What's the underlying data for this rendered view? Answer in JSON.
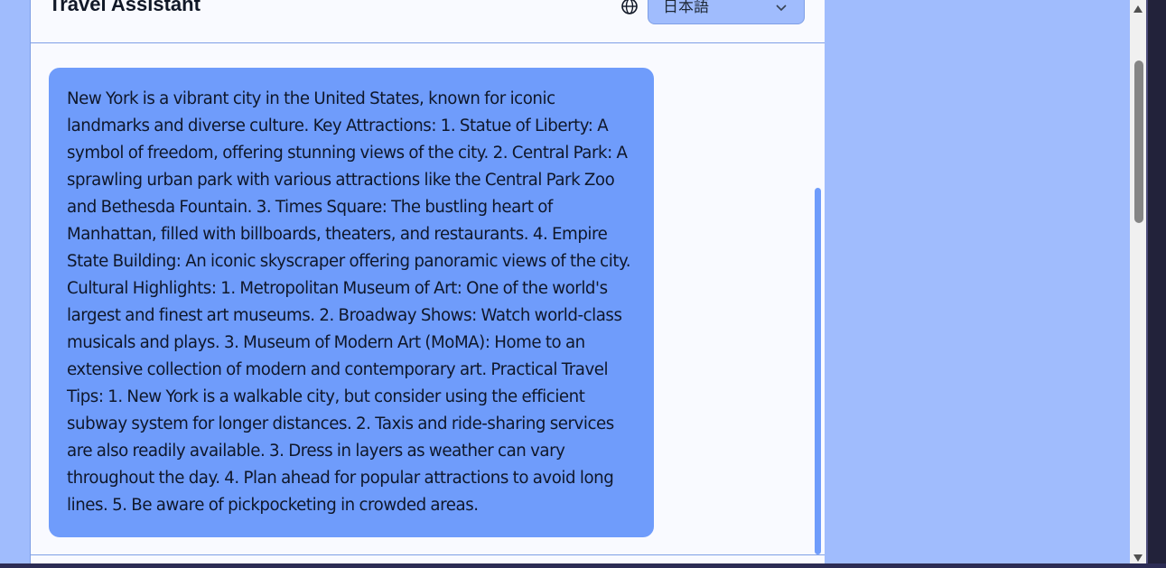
{
  "header": {
    "title": "Travel Assistant",
    "language_select": {
      "value": "日本語",
      "icon": "globe-icon",
      "chevron": "chevron-down-icon"
    }
  },
  "chat": {
    "messages": [
      {
        "role": "assistant",
        "text": "New York is a vibrant city in the United States, known for iconic landmarks and diverse culture. Key Attractions: 1. Statue of Liberty: A symbol of freedom, offering stunning views of the city. 2. Central Park: A sprawling urban park with various attractions like the Central Park Zoo and Bethesda Fountain. 3. Times Square: The bustling heart of Manhattan, filled with billboards, theaters, and restaurants. 4. Empire State Building: An iconic skyscraper offering panoramic views of the city. Cultural Highlights: 1. Metropolitan Museum of Art: One of the world's largest and finest art museums. 2. Broadway Shows: Watch world-class musicals and plays. 3. Museum of Modern Art (MoMA): Home to an extensive collection of modern and contemporary art. Practical Travel Tips: 1. New York is a walkable city, but consider using the efficient subway system for longer distances. 2. Taxis and ride-sharing services are also readily available. 3. Dress in layers as weather can vary throughout the day. 4. Plan ahead for popular attractions to avoid long lines. 5. Be aware of pickpocketing in crowded areas."
      }
    ]
  },
  "colors": {
    "page_background": "#a0bcfd",
    "panel_background": "#f9faff",
    "bubble_background": "#6f9cfb",
    "border": "#7f9fe6"
  }
}
